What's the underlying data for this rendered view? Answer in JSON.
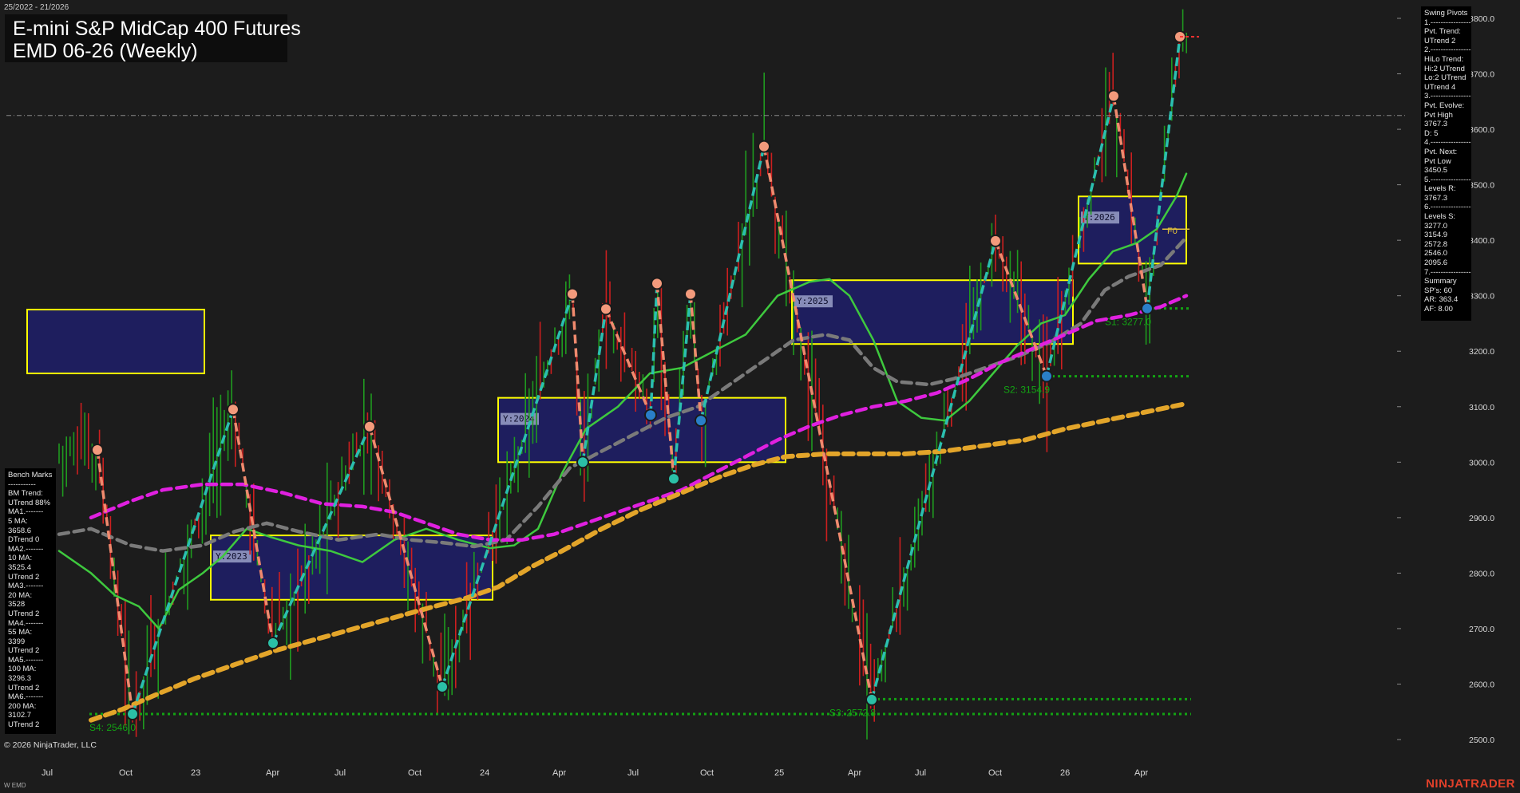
{
  "header": {
    "date_range": "25/2022 - 21/2026",
    "title": "E-mini S&P MidCap 400 Futures",
    "subtitle": "EMD 06-26 (Weekly)"
  },
  "colors": {
    "background": "#1c1c1c",
    "up_bar": "#1f9a1f",
    "down_bar": "#cc1f1f",
    "pivot_high_dash": "#f08a6e",
    "pivot_low_dash": "#2bbfb0",
    "ma_short": "#3ec93e",
    "ma_mid_gray": "#7a7a7a",
    "ma_magenta": "#e020e0",
    "ma_long_gold": "#e3a52a",
    "year_box_fill": "#1e1e5e",
    "year_box_border": "#ffff00",
    "support_dots": "#13a313",
    "brand": "#e2402a"
  },
  "swing_panel": [
    "Swing Pivots",
    "1.----------------",
    "Pvt. Trend:",
    "UTrend 2",
    "2.----------------",
    "HiLo Trend:",
    "Hi:2 UTrend",
    "Lo:2 UTrend",
    "UTrend 4",
    "3.----------------",
    "Pvt. Evolve:",
    "Pvt High",
    "3767.3",
    "D: 5",
    "4.----------------",
    "Pvt. Next:",
    "Pvt Low",
    "3450.5",
    "5.----------------",
    "Levels R:",
    "3767.3",
    "6.----------------",
    "Levels S:",
    "3277.0",
    "3154.9",
    "2572.8",
    "2546.0",
    "2095.6",
    "7.----------------",
    "Summary",
    "SP's: 60",
    "AR: 363.4",
    "AF: 8.00"
  ],
  "bench_panel": [
    "Bench Marks",
    "-----------",
    "BM Trend:",
    "UTrend 88%",
    "MA1.-------",
    "5 MA:",
    "3658.6",
    "DTrend 0",
    "MA2.-------",
    "10 MA:",
    "3525.4",
    "UTrend 2",
    "MA3.-------",
    "20 MA:",
    "3528",
    "UTrend 2",
    "MA4.-------",
    "55 MA:",
    "3399",
    "UTrend 2",
    "MA5.-------",
    "100 MA:",
    "3296.3",
    "UTrend 2",
    "MA6.-------",
    "200 MA:",
    "3102.7",
    "UTrend 2"
  ],
  "footer": {
    "copyright": "© 2026 NinjaTrader, LLC",
    "instrument": "W EMD",
    "brand": "NINJATRADER"
  },
  "chart_data": {
    "type": "line",
    "price_axis": {
      "ylim": [
        2450,
        3840
      ],
      "ticks": [
        "3800.0",
        "3700.0",
        "3600.0",
        "3500.0",
        "3400.0",
        "3300.0",
        "3200.0",
        "3100.0",
        "3000.0",
        "2900.0",
        "2800.0",
        "2700.0",
        "2600.0",
        "2500.0"
      ]
    },
    "time_axis": {
      "xlim": [
        0,
        1410
      ],
      "tick_labels": [
        {
          "label": "Jul",
          "x": 0
        },
        {
          "label": "Oct",
          "x": 97
        },
        {
          "label": "23",
          "x": 187
        },
        {
          "label": "Apr",
          "x": 281
        },
        {
          "label": "Jul",
          "x": 367
        },
        {
          "label": "Oct",
          "x": 459
        },
        {
          "label": "24",
          "x": 549
        },
        {
          "label": "Apr",
          "x": 640
        },
        {
          "label": "Jul",
          "x": 734
        },
        {
          "label": "Oct",
          "x": 825
        },
        {
          "label": "25",
          "x": 918
        },
        {
          "label": "Apr",
          "x": 1010
        },
        {
          "label": "Jul",
          "x": 1094
        },
        {
          "label": "Oct",
          "x": 1186
        },
        {
          "label": "26",
          "x": 1276
        },
        {
          "label": "Apr",
          "x": 1369
        }
      ]
    },
    "swing_pivots": [
      {
        "x": 48,
        "y": 3022,
        "type": "high"
      },
      {
        "x": 92,
        "y": 2546,
        "type": "low"
      },
      {
        "x": 218,
        "y": 3095,
        "type": "high"
      },
      {
        "x": 268,
        "y": 2674,
        "type": "low"
      },
      {
        "x": 389,
        "y": 3064,
        "type": "high"
      },
      {
        "x": 480,
        "y": 2595,
        "type": "low"
      },
      {
        "x": 643,
        "y": 3303,
        "type": "high"
      },
      {
        "x": 656,
        "y": 3000,
        "type": "low"
      },
      {
        "x": 685,
        "y": 3276,
        "type": "high"
      },
      {
        "x": 741,
        "y": 3085,
        "type": "low"
      },
      {
        "x": 749,
        "y": 3322,
        "type": "high"
      },
      {
        "x": 770,
        "y": 2970,
        "type": "low"
      },
      {
        "x": 791,
        "y": 3303,
        "type": "high"
      },
      {
        "x": 804,
        "y": 3075,
        "type": "low"
      },
      {
        "x": 883,
        "y": 3569,
        "type": "high"
      },
      {
        "x": 1018,
        "y": 2572,
        "type": "low"
      },
      {
        "x": 1173,
        "y": 3399,
        "type": "high"
      },
      {
        "x": 1237,
        "y": 3155,
        "type": "low"
      },
      {
        "x": 1321,
        "y": 3660,
        "type": "high"
      },
      {
        "x": 1363,
        "y": 3277,
        "type": "low"
      },
      {
        "x": 1404,
        "y": 3767,
        "type": "high"
      }
    ],
    "series": [
      {
        "name": "5 MA",
        "color": "#3ec93e",
        "dash": false,
        "points": [
          [
            0,
            2840
          ],
          [
            40,
            2800
          ],
          [
            70,
            2760
          ],
          [
            100,
            2740
          ],
          [
            125,
            2700
          ],
          [
            150,
            2770
          ],
          [
            180,
            2800
          ],
          [
            205,
            2830
          ],
          [
            235,
            2880
          ],
          [
            265,
            2865
          ],
          [
            300,
            2850
          ],
          [
            340,
            2840
          ],
          [
            380,
            2820
          ],
          [
            420,
            2860
          ],
          [
            460,
            2880
          ],
          [
            500,
            2860
          ],
          [
            540,
            2845
          ],
          [
            570,
            2850
          ],
          [
            600,
            2880
          ],
          [
            630,
            2980
          ],
          [
            660,
            3060
          ],
          [
            700,
            3100
          ],
          [
            740,
            3160
          ],
          [
            780,
            3170
          ],
          [
            820,
            3200
          ],
          [
            860,
            3230
          ],
          [
            900,
            3300
          ],
          [
            940,
            3325
          ],
          [
            965,
            3330
          ],
          [
            990,
            3300
          ],
          [
            1020,
            3220
          ],
          [
            1050,
            3110
          ],
          [
            1080,
            3080
          ],
          [
            1110,
            3075
          ],
          [
            1140,
            3110
          ],
          [
            1170,
            3160
          ],
          [
            1200,
            3210
          ],
          [
            1230,
            3250
          ],
          [
            1260,
            3265
          ],
          [
            1290,
            3330
          ],
          [
            1320,
            3380
          ],
          [
            1350,
            3395
          ],
          [
            1375,
            3420
          ],
          [
            1400,
            3480
          ],
          [
            1412,
            3520
          ]
        ]
      },
      {
        "name": "20 MA",
        "color": "#7a7a7a",
        "dash": true,
        "points": [
          [
            0,
            2870
          ],
          [
            40,
            2880
          ],
          [
            90,
            2850
          ],
          [
            130,
            2840
          ],
          [
            180,
            2850
          ],
          [
            220,
            2875
          ],
          [
            260,
            2890
          ],
          [
            300,
            2875
          ],
          [
            350,
            2860
          ],
          [
            400,
            2870
          ],
          [
            440,
            2860
          ],
          [
            480,
            2855
          ],
          [
            520,
            2848
          ],
          [
            560,
            2860
          ],
          [
            600,
            2920
          ],
          [
            640,
            2990
          ],
          [
            680,
            3020
          ],
          [
            720,
            3050
          ],
          [
            760,
            3080
          ],
          [
            800,
            3100
          ],
          [
            840,
            3140
          ],
          [
            880,
            3180
          ],
          [
            920,
            3220
          ],
          [
            960,
            3230
          ],
          [
            990,
            3220
          ],
          [
            1020,
            3170
          ],
          [
            1050,
            3145
          ],
          [
            1090,
            3140
          ],
          [
            1120,
            3150
          ],
          [
            1160,
            3170
          ],
          [
            1200,
            3190
          ],
          [
            1240,
            3215
          ],
          [
            1280,
            3250
          ],
          [
            1310,
            3310
          ],
          [
            1340,
            3335
          ],
          [
            1380,
            3355
          ],
          [
            1412,
            3405
          ]
        ]
      },
      {
        "name": "55 MA",
        "color": "#e020e0",
        "dash": true,
        "points": [
          [
            40,
            2900
          ],
          [
            90,
            2930
          ],
          [
            130,
            2950
          ],
          [
            180,
            2960
          ],
          [
            230,
            2960
          ],
          [
            280,
            2945
          ],
          [
            330,
            2925
          ],
          [
            380,
            2920
          ],
          [
            420,
            2910
          ],
          [
            460,
            2890
          ],
          [
            500,
            2870
          ],
          [
            540,
            2860
          ],
          [
            580,
            2860
          ],
          [
            620,
            2870
          ],
          [
            660,
            2890
          ],
          [
            700,
            2910
          ],
          [
            740,
            2930
          ],
          [
            780,
            2950
          ],
          [
            820,
            2980
          ],
          [
            860,
            3010
          ],
          [
            900,
            3040
          ],
          [
            940,
            3065
          ],
          [
            980,
            3085
          ],
          [
            1020,
            3100
          ],
          [
            1060,
            3110
          ],
          [
            1100,
            3125
          ],
          [
            1140,
            3150
          ],
          [
            1180,
            3180
          ],
          [
            1220,
            3205
          ],
          [
            1260,
            3230
          ],
          [
            1300,
            3255
          ],
          [
            1340,
            3265
          ],
          [
            1380,
            3280
          ],
          [
            1412,
            3300
          ]
        ]
      },
      {
        "name": "200 MA",
        "color": "#e3a52a",
        "dash": true,
        "points": [
          [
            40,
            2535
          ],
          [
            80,
            2555
          ],
          [
            120,
            2580
          ],
          [
            170,
            2610
          ],
          [
            220,
            2635
          ],
          [
            270,
            2660
          ],
          [
            320,
            2680
          ],
          [
            370,
            2700
          ],
          [
            420,
            2720
          ],
          [
            470,
            2740
          ],
          [
            510,
            2755
          ],
          [
            550,
            2775
          ],
          [
            590,
            2810
          ],
          [
            630,
            2840
          ],
          [
            680,
            2880
          ],
          [
            730,
            2915
          ],
          [
            780,
            2945
          ],
          [
            830,
            2975
          ],
          [
            870,
            2995
          ],
          [
            910,
            3010
          ],
          [
            960,
            3015
          ],
          [
            1010,
            3015
          ],
          [
            1060,
            3015
          ],
          [
            1110,
            3020
          ],
          [
            1160,
            3030
          ],
          [
            1210,
            3040
          ],
          [
            1260,
            3060
          ],
          [
            1310,
            3075
          ],
          [
            1360,
            3090
          ],
          [
            1410,
            3105
          ]
        ]
      }
    ],
    "year_boxes": [
      {
        "label": "",
        "x0": -40,
        "x1": 182,
        "y_top": 3275,
        "y_bottom": 3160
      },
      {
        "label": "Y:2023",
        "x0": 190,
        "x1": 543,
        "y_top": 2868,
        "y_bottom": 2752
      },
      {
        "label": "Y:2024",
        "x0": 550,
        "x1": 910,
        "y_top": 3116,
        "y_bottom": 3000
      },
      {
        "label": "Y:2025",
        "x0": 918,
        "x1": 1270,
        "y_top": 3328,
        "y_bottom": 3213
      },
      {
        "label": "Y:2026",
        "x0": 1277,
        "x1": 1412,
        "y_top": 3479,
        "y_bottom": 3358
      }
    ],
    "support_levels": [
      {
        "label": "S4: 2546.0",
        "value": 2546,
        "x0": 38,
        "x1": 1418,
        "label_x": 38
      },
      {
        "label": "S3: 2572.8",
        "value": 2572.8,
        "x0": 1018,
        "x1": 1418,
        "label_x": 965
      },
      {
        "label": "S2: 3154.9",
        "value": 3154.9,
        "x0": 1237,
        "x1": 1418,
        "label_x": 1183
      },
      {
        "label": "S1: 3277.0",
        "value": 3277,
        "x0": 1363,
        "x1": 1418,
        "label_x": 1310
      }
    ],
    "reference_line": 3625,
    "f0_label": {
      "text": "F0",
      "x": 1388,
      "y": 3412
    },
    "f0_line": {
      "value": 3420
    }
  }
}
